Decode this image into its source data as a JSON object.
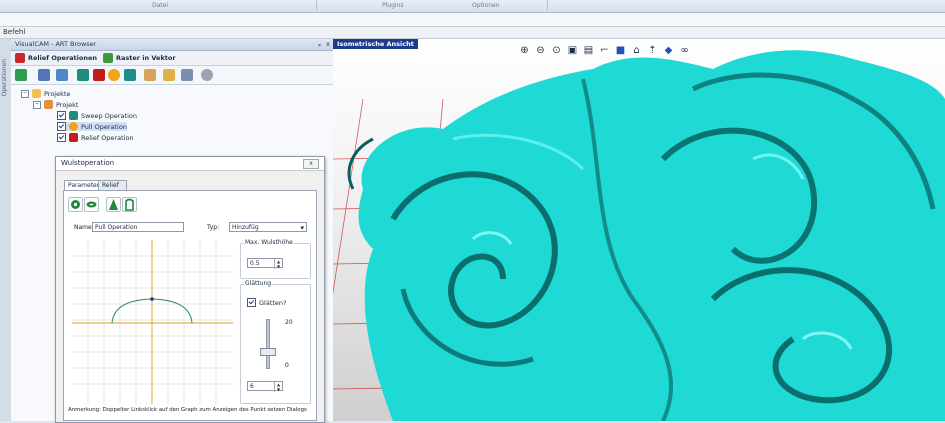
{
  "ribbon": {
    "groups": [
      "Datei",
      "Plugins",
      "Optionen"
    ]
  },
  "command_bar": {
    "label": "Befehl"
  },
  "side_tab": {
    "label": "Operationen"
  },
  "panel": {
    "title": "VisualCAM - ART Browser",
    "pin": "ᵩ",
    "close": "x",
    "toolbar": {
      "relief_ops": "Relief Operationen",
      "raster_vektor": "Raster in Vektor"
    },
    "icons": [
      "new-relief-icon",
      "layers-icon",
      "tree-icon",
      "sweep-icon",
      "emboss-icon",
      "pill-icon",
      "chisel-icon",
      "flatten-icon",
      "pour-icon",
      "image-icon",
      "settings-icon"
    ]
  },
  "tree": {
    "root": "Projekte",
    "project": "Projekt",
    "operations": [
      {
        "label": "Sweep Operation",
        "color": "#1f8b7c"
      },
      {
        "label": "Pull Operation",
        "color": "#f3a319"
      },
      {
        "label": "Relief Operation",
        "color": "#c01c1c"
      }
    ]
  },
  "dialog": {
    "title": "Wulstoperation",
    "close": "x",
    "tabs": [
      "Parameter",
      "Relief Kurven"
    ],
    "name_label": "Name",
    "name_value": "Pull Operation",
    "type_label": "Typ:",
    "type_value": "Hinzufüg",
    "max_height_label": "Max. Wulsthöhe",
    "max_height_value": "0.5",
    "smoothing_label": "Glättung",
    "smooth_check_label": "Glätten?",
    "slider_max": "20",
    "slider_min": "0",
    "smooth_value": "6",
    "hint": "Anmerkung: Doppelter Linksklick auf den Graph zum Anzeigen des Punkt setzen Dialogs"
  },
  "viewport": {
    "title": "Isometrische Ansicht",
    "tools": [
      "zoom-in-icon",
      "zoom-out-icon",
      "zoom-extents-icon",
      "zoom-window-icon",
      "top-view-icon",
      "front-view-icon",
      "side-view-icon",
      "home-view-icon",
      "iso-view-icon",
      "box-view-icon",
      "render-icon"
    ],
    "relief_color": "#1ed9d4",
    "grid_color": "#c8262b"
  }
}
